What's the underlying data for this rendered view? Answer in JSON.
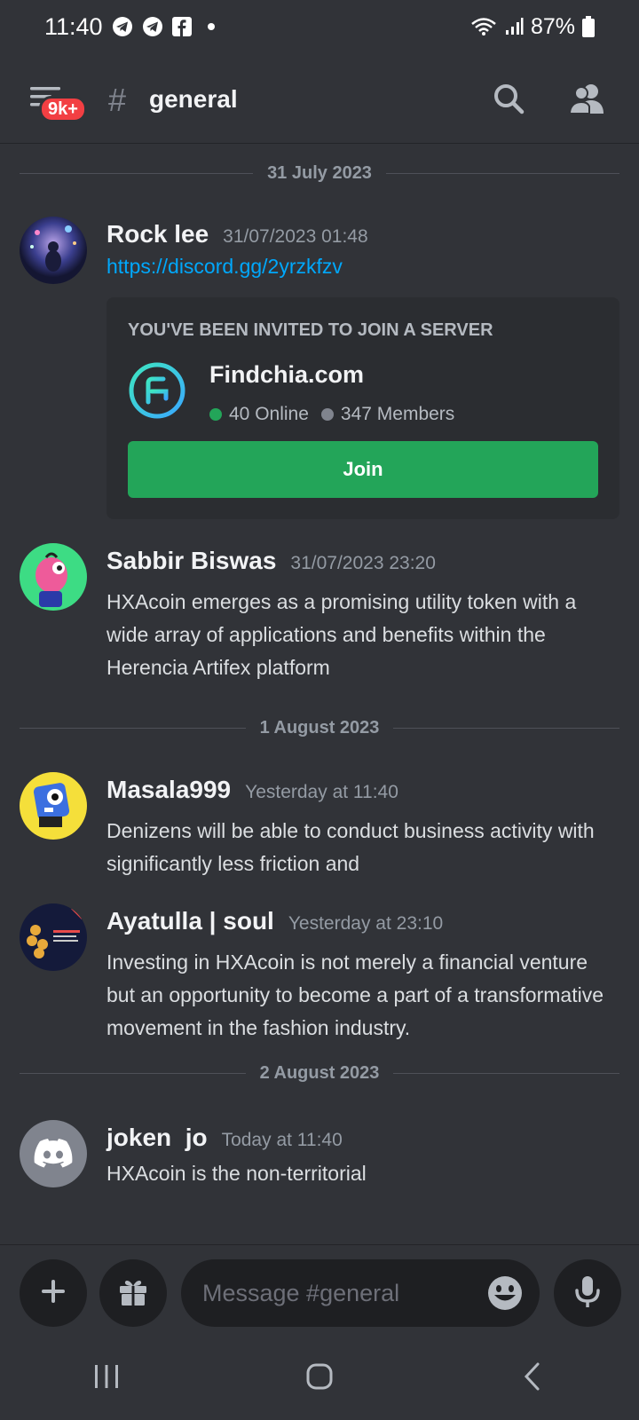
{
  "status_bar": {
    "time": "11:40",
    "battery": "87%",
    "notification_icons": [
      "telegram-icon",
      "telegram-icon",
      "facebook-icon"
    ]
  },
  "header": {
    "badge": "9k+",
    "hash": "#",
    "channel": "general"
  },
  "dividers": [
    "31 July 2023",
    "1 August 2023",
    "2 August 2023"
  ],
  "messages": [
    {
      "author": "Rock lee",
      "time": "31/07/2023 01:48",
      "text": "https://discord.gg/2yrzkfzv",
      "invite": {
        "heading": "YOU'VE BEEN INVITED TO JOIN A SERVER",
        "server_name": "Findchia.com",
        "online": "40 Online",
        "members": "347 Members",
        "join_label": "Join"
      }
    },
    {
      "author": "Sabbir Biswas",
      "time": "31/07/2023 23:20",
      "text": "HXAcoin emerges as a promising utility token with a wide array of applications and benefits within the Herencia Artifex platform"
    },
    {
      "author": "Masala999",
      "time": "Yesterday at 11:40",
      "text": "Denizens will be able to conduct business activity with significantly less friction and"
    },
    {
      "author": "Ayatulla | soul",
      "time": "Yesterday at 23:10",
      "text": "Investing in HXAcoin is not merely a financial venture but an opportunity to become a part of a transformative movement in the fashion industry."
    },
    {
      "author": "joken  jo",
      "time": "Today at 11:40",
      "text": "HXAcoin is the non-territorial"
    }
  ],
  "composer": {
    "placeholder": "Message #general"
  },
  "colors": {
    "background": "#313338",
    "join_button": "#23a559",
    "badge": "#f23f43",
    "link": "#00a8fc",
    "online_dot": "#23a559"
  }
}
